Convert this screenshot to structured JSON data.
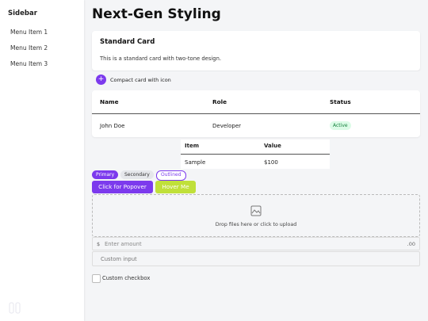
{
  "sidebar": {
    "title": "Sidebar",
    "items": [
      {
        "label": "Menu Item 1"
      },
      {
        "label": "Menu Item 2"
      },
      {
        "label": "Menu Item 3"
      }
    ]
  },
  "main": {
    "title": "Next-Gen Styling",
    "standard_card": {
      "title": "Standard Card",
      "text": "This is a standard card with two-tone design."
    },
    "compact_card": {
      "icon": "plus-icon",
      "text": "Compact card with icon"
    },
    "table1": {
      "headers": [
        "Name",
        "Role",
        "Status"
      ],
      "rows": [
        {
          "name": "John Doe",
          "role": "Developer",
          "status": "Active"
        }
      ]
    },
    "table2": {
      "headers": [
        "Item",
        "Value"
      ],
      "rows": [
        {
          "item": "Sample",
          "value": "$100"
        }
      ]
    },
    "pills": {
      "primary": "Primary",
      "secondary": "Secondary",
      "outlined": "Outlined"
    },
    "buttons": {
      "popover": "Click for Popover",
      "hover": "Hover Me"
    },
    "dropzone": {
      "icon": "image-icon",
      "text": "Drop files here or click to upload"
    },
    "amount_field": {
      "prefix": "$",
      "placeholder": "Enter amount",
      "suffix": ".00"
    },
    "custom_input": {
      "placeholder": "Custom input"
    },
    "checkbox": {
      "label": "Custom checkbox",
      "checked": false
    }
  },
  "colors": {
    "accent": "#7c3aed",
    "lime": "#c0e03a",
    "status_active": "#15803d",
    "status_active_bg": "#dcfce7",
    "background": "#f4f5f7"
  }
}
